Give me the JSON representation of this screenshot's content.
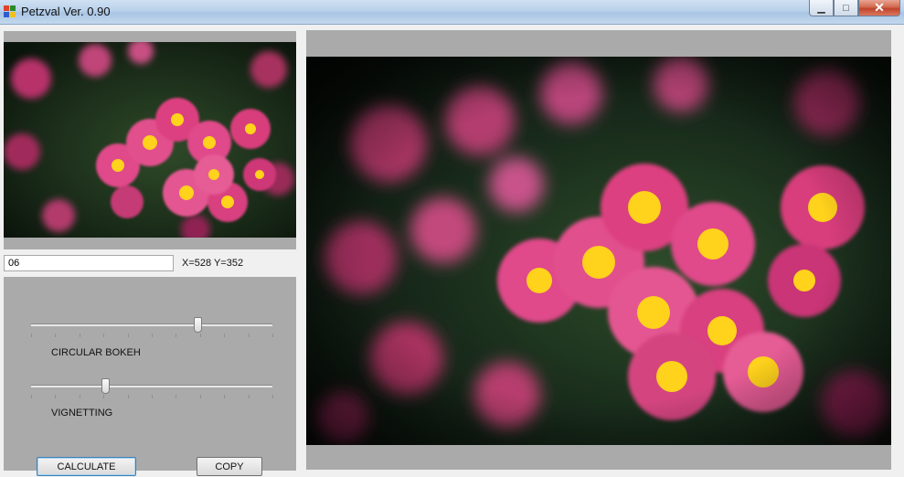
{
  "window": {
    "title": "Petzval Ver. 0.90",
    "controls": {
      "minimize": "▁",
      "maximize": "□",
      "close": "✕"
    }
  },
  "thumbnail": {
    "alt": "flower photo preview"
  },
  "path_field": {
    "value": "06"
  },
  "cursor_readout": "X=528 Y=352",
  "sliders": {
    "circular_bokeh": {
      "label": "CIRCULAR BOKEH",
      "value": 0.69
    },
    "vignetting": {
      "label": "VIGNETTING",
      "value": 0.31
    }
  },
  "buttons": {
    "calculate": "CALCULATE",
    "copy": "COPY"
  },
  "colors": {
    "panel_gray": "#aaaaaa",
    "petal_pink": "#d2246e",
    "flower_center": "#f2b400",
    "foliage": "#1f3a1e"
  },
  "icons": {
    "app": "app-icon"
  }
}
